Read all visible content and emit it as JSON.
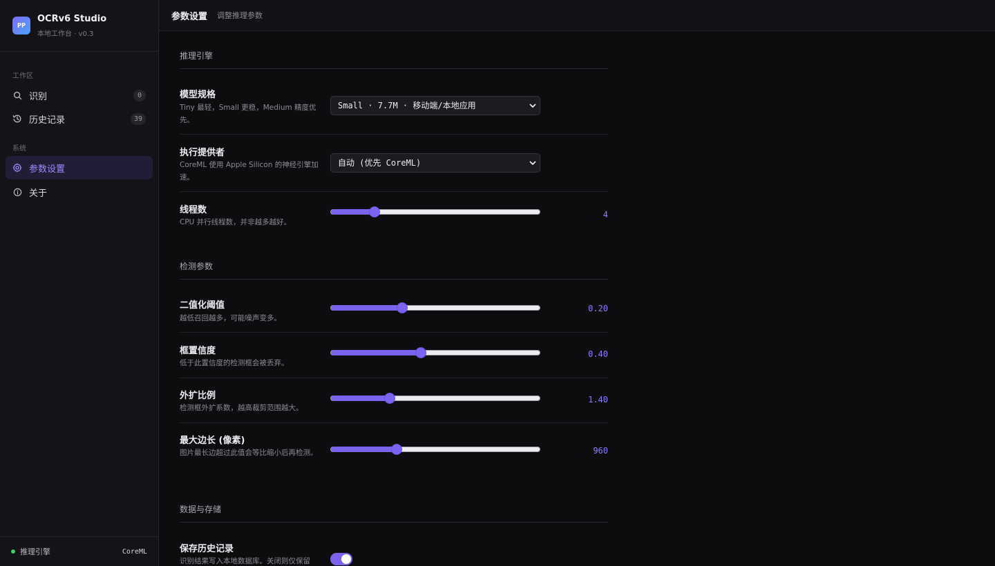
{
  "app": {
    "logo_text": "PP",
    "name": "OCRv6 Studio",
    "subtitle": "本地工作台 · v0.3"
  },
  "sidebar": {
    "groups": [
      {
        "label": "工作区"
      },
      {
        "label": "系统"
      }
    ],
    "items": [
      {
        "label": "识别",
        "icon": "search-icon",
        "badge": "0"
      },
      {
        "label": "历史记录",
        "icon": "history-icon",
        "badge": "39"
      },
      {
        "label": "参数设置",
        "icon": "gear-icon",
        "active": true
      },
      {
        "label": "关于",
        "icon": "info-icon"
      }
    ],
    "footer": {
      "status_label": "推理引擎",
      "engine": "CoreML",
      "status_color": "#3ccf6e"
    }
  },
  "header": {
    "title": "参数设置",
    "subtitle": "调整推理参数"
  },
  "sections": [
    {
      "title": "推理引擎",
      "rows": [
        {
          "label": "模型规格",
          "desc": "Tiny 最轻，Small 更稳，Medium 精度优先。",
          "control": "select",
          "value": "Small · 7.7M · 移动端/本地应用"
        },
        {
          "label": "执行提供者",
          "desc": "CoreML 使用 Apple Silicon 的神经引擎加速。",
          "control": "select",
          "value": "自动 (优先 CoreML)"
        },
        {
          "label": "线程数",
          "desc": "CPU 并行线程数，并非越多越好。",
          "control": "slider",
          "value": "4",
          "fraction": 0.21
        }
      ]
    },
    {
      "title": "检测参数",
      "rows": [
        {
          "label": "二值化阈值",
          "desc": "越低召回越多，可能噪声变多。",
          "control": "slider",
          "value": "0.20",
          "fraction": 0.34
        },
        {
          "label": "框置信度",
          "desc": "低于此置信度的检测框会被丢弃。",
          "control": "slider",
          "value": "0.40",
          "fraction": 0.43
        },
        {
          "label": "外扩比例",
          "desc": "检测框外扩系数，越高裁剪范围越大。",
          "control": "slider",
          "value": "1.40",
          "fraction": 0.28
        },
        {
          "label": "最大边长 (像素)",
          "desc": "图片最长边超过此值会等比缩小后再检测。",
          "control": "slider",
          "value": "960",
          "fraction": 0.315
        }
      ]
    },
    {
      "title": "数据与存储",
      "rows": [
        {
          "label": "保存历史记录",
          "desc": "识别结果写入本地数据库。关闭则仅保留",
          "control": "toggle",
          "value": true
        }
      ]
    }
  ],
  "colors": {
    "accent": "#7b62ef",
    "accent_text": "#8d7cff",
    "background": "#0d0d10"
  }
}
